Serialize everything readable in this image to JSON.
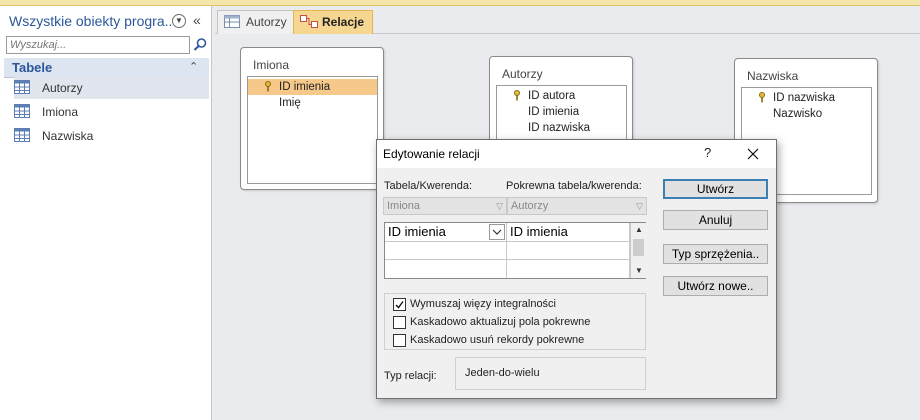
{
  "nav": {
    "title": "Wszystkie obiekty progra...",
    "search_placeholder": "Wyszukaj...",
    "group_title": "Tabele",
    "items": [
      {
        "label": "Autorzy"
      },
      {
        "label": "Imiona"
      },
      {
        "label": "Nazwiska"
      }
    ]
  },
  "tabs": [
    {
      "label": "Autorzy"
    },
    {
      "label": "Relacje"
    }
  ],
  "tables": {
    "imiona": {
      "title": "Imiona",
      "fields": [
        "ID imienia",
        "Imię"
      ]
    },
    "autorzy": {
      "title": "Autorzy",
      "fields": [
        "ID autora",
        "ID imienia",
        "ID nazwiska"
      ]
    },
    "nazwiska": {
      "title": "Nazwiska",
      "fields": [
        "ID nazwiska",
        "Nazwisko"
      ]
    }
  },
  "dialog": {
    "title": "Edytowanie relacji",
    "help": "?",
    "table_label": "Tabela/Kwerenda:",
    "related_label": "Pokrewna tabela/kwerenda:",
    "table_value": "Imiona",
    "related_value": "Autorzy",
    "grid_left": "ID imienia",
    "grid_right": "ID imienia",
    "checkboxes": [
      {
        "label": "Wymuszaj więzy integralności",
        "checked": true
      },
      {
        "label": "Kaskadowo aktualizuj pola pokrewne",
        "checked": false
      },
      {
        "label": "Kaskadowo usuń rekordy pokrewne",
        "checked": false
      }
    ],
    "reltype_label": "Typ relacji:",
    "reltype_value": "Jeden-do-wielu",
    "buttons": {
      "create": "Utwórz",
      "cancel": "Anuluj",
      "join_type": "Typ sprzężenia..",
      "create_new": "Utwórz nowe.."
    }
  },
  "colors": {
    "accent": "#2b579a",
    "active_tab": "#f6d791",
    "field_highlight": "#f6c88a"
  }
}
